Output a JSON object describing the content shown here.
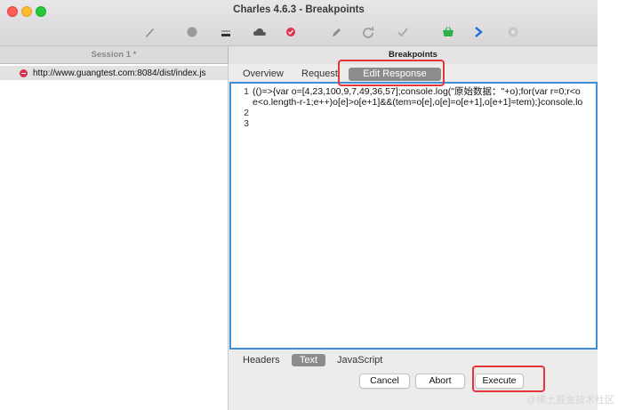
{
  "window": {
    "title": "Charles 4.6.3 - Breakpoints"
  },
  "toolbar": {
    "icons": [
      "pen-icon",
      "record-icon",
      "throttle-icon",
      "cloud-icon",
      "breakpoint-icon",
      "edit-icon",
      "refresh-icon",
      "check-icon",
      "basket-icon",
      "forward-icon",
      "settings-icon"
    ]
  },
  "tabs": {
    "session": "Session 1 *",
    "breakpoints": "Breakpoints"
  },
  "request_list": [
    {
      "url": "http://www.guangtest.com:8084/dist/index.js"
    }
  ],
  "detail_tabs": {
    "overview": "Overview",
    "request": "Request",
    "edit_response": "Edit Response"
  },
  "editor": {
    "line_numbers": [
      "1",
      "",
      "2",
      "3"
    ],
    "lines": [
      "(()=>{var o=[4,23,100,9,7,49,36,57];console.log(\"原始数据：\"+o);for(var r=0;r<o",
      "e<o.length-r-1;e++)o[e]>o[e+1]&&(tem=o[e],o[e]=o[e+1],o[e+1]=tem);}console.lo",
      "",
      ""
    ]
  },
  "body_tabs": {
    "headers": "Headers",
    "text": "Text",
    "javascript": "JavaScript"
  },
  "buttons": {
    "cancel": "Cancel",
    "abort": "Abort",
    "execute": "Execute"
  },
  "watermark": "@稀土掘金技术社区",
  "colors": {
    "accent": "#3f8fd8",
    "highlight": "#e5353b",
    "breakpoint": "#d6304a"
  }
}
